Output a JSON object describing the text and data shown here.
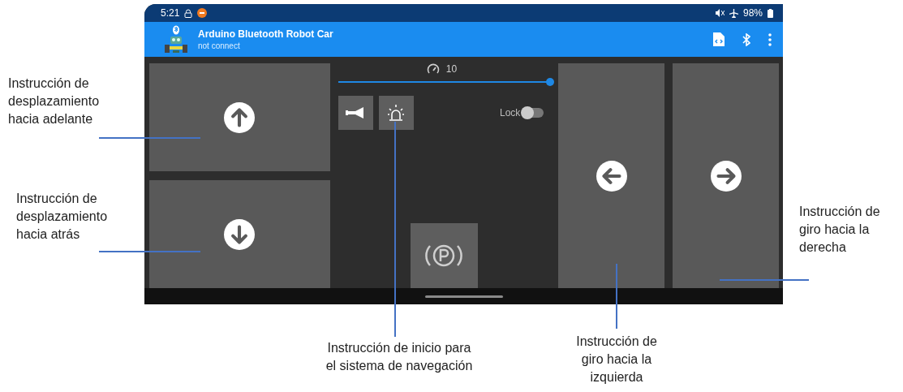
{
  "status_bar": {
    "time": "5:21",
    "battery": "98%"
  },
  "app_bar": {
    "title": "Arduino Bluetooth Robot Car",
    "subtitle": "not connect"
  },
  "controls": {
    "speed": {
      "value": "10",
      "level": 1.0
    },
    "lock": {
      "label": "Lock",
      "on": false
    }
  },
  "annotations": [
    {
      "text": "Instrucción de\ndesplazamiento\nhacia adelante"
    },
    {
      "text": "Instrucción de\ndesplazamiento\nhacia atrás"
    },
    {
      "text": "Instrucción de\ngiro hacia la\nderecha"
    },
    {
      "text": "Instrucción de inicio para\nel sistema de navegación"
    },
    {
      "text": "Instrucción de\ngiro hacia la\nizquierda"
    }
  ]
}
